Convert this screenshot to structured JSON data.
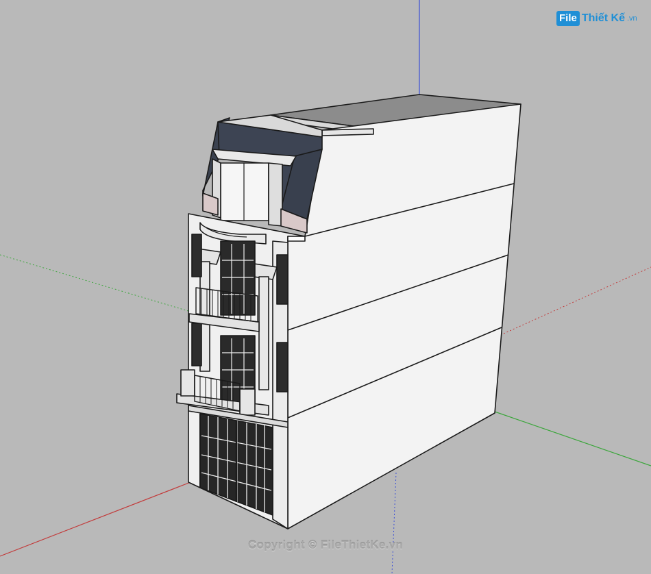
{
  "watermark": {
    "logo_badge": "File",
    "logo_text": "Thiết Kế",
    "logo_suffix": ".vn",
    "copyright": "Copyright © FileThietKe.vn"
  },
  "colors": {
    "background": "#b9b9b9",
    "axis_red": "#c23b3b",
    "axis_green": "#3aa63a",
    "axis_blue": "#3b4fd6",
    "wall_white": "#f2f2f2",
    "wall_side": "#ececec",
    "roof_tile": "#3b4250",
    "brand": "#1f8fd6"
  },
  "model": {
    "name": "townhouse-model",
    "floors": 4
  }
}
